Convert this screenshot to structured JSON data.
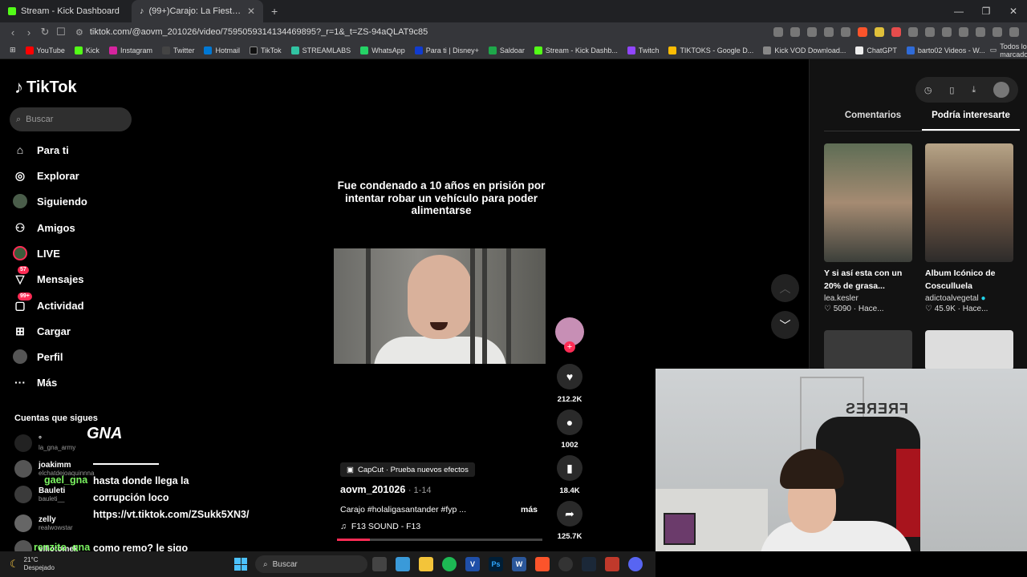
{
  "browser": {
    "tabs": [
      {
        "label": "Stream - Kick Dashboard",
        "active": false
      },
      {
        "label": "(99+)Carajo: La Fiesta en La Liga",
        "active": true
      }
    ],
    "url": "tiktok.com/@aovm_201026/video/7595059314134469895?_r=1&_t=ZS-94aQLAT9c85",
    "bookmarks": [
      "YouTube",
      "Kick",
      "Instagram",
      "Twitter",
      "Hotmail",
      "TikTok",
      "STREAMLABS",
      "WhatsApp",
      "Para ti | Disney+",
      "Saldoar",
      "Stream - Kick Dashb...",
      "Twitch",
      "TIKTOKS - Google D...",
      "Kick VOD Download...",
      "ChatGPT",
      "barto02 Videos - W..."
    ],
    "all_bookmarks": "Todos los marcadores"
  },
  "tiktok": {
    "brand": "TikTok",
    "search_placeholder": "Buscar",
    "nav": [
      {
        "label": "Para ti",
        "icon": "home-icon"
      },
      {
        "label": "Explorar",
        "icon": "compass-icon"
      },
      {
        "label": "Siguiendo",
        "icon": "following-icon"
      },
      {
        "label": "Amigos",
        "icon": "friends-icon"
      },
      {
        "label": "LIVE",
        "icon": "live-icon"
      },
      {
        "label": "Mensajes",
        "icon": "messages-icon",
        "badge": "57"
      },
      {
        "label": "Actividad",
        "icon": "activity-icon",
        "badge": "99+"
      },
      {
        "label": "Cargar",
        "icon": "upload-icon"
      },
      {
        "label": "Perfil",
        "icon": "profile-icon"
      },
      {
        "label": "Más",
        "icon": "more-icon"
      }
    ],
    "following_title": "Cuentas que sigues",
    "following": [
      {
        "name": "°",
        "handle": "la_gna_army"
      },
      {
        "name": "joakimm",
        "handle": "elchatdejoaquinnna"
      },
      {
        "name": "Bauleti",
        "handle": "bauleti__"
      },
      {
        "name": "zelly",
        "handle": "realwowstar"
      },
      {
        "name": "elliotomek",
        "handle": ""
      }
    ]
  },
  "video": {
    "overlay_text": "Fue condenado a 10 años en prisión por intentar robar un vehículo para poder alimentarse",
    "capcut": "CapCut · Prueba nuevos efectos",
    "author": "aovm_201026",
    "date": "· 1-14",
    "caption": "Carajo #holaligasantander #fyp ...",
    "more": "más",
    "sound": "F13 SOUND - F13",
    "progress": 0.16,
    "likes": "212.2K",
    "comments": "1002",
    "saves": "18.4K",
    "shares": "125.7K"
  },
  "right_panel": {
    "tabs": [
      "Comentarios",
      "Podría interesarte"
    ],
    "active_tab": 1,
    "cards": [
      {
        "title": "Y si así esta con un 20% de grasa...",
        "user": "lea.kesler",
        "meta": "♡ 5090 · Hace..."
      },
      {
        "title": "Album Icónico de Cosculluela",
        "user": "adictoalvegetal",
        "meta": "♡ 45.9K · Hace..."
      }
    ]
  },
  "chat": {
    "logo": "GNA",
    "lines": [
      {
        "name": "",
        "text": "hasta donde llega la corrupción loco https://vt.tiktok.com/ZSukk5XN3/"
      },
      {
        "name": "gael_gna",
        "text": ""
      },
      {
        "name": "renzito_gna",
        "text": "como remo? le sigo hablando y tirando"
      }
    ]
  },
  "webcam": {
    "text": "FRERES"
  },
  "taskbar": {
    "temp": "21°C",
    "weather": "Despejado",
    "search": "Buscar"
  },
  "colors": {
    "accent": "#fe2c55",
    "chat_name": "#7cf562"
  }
}
